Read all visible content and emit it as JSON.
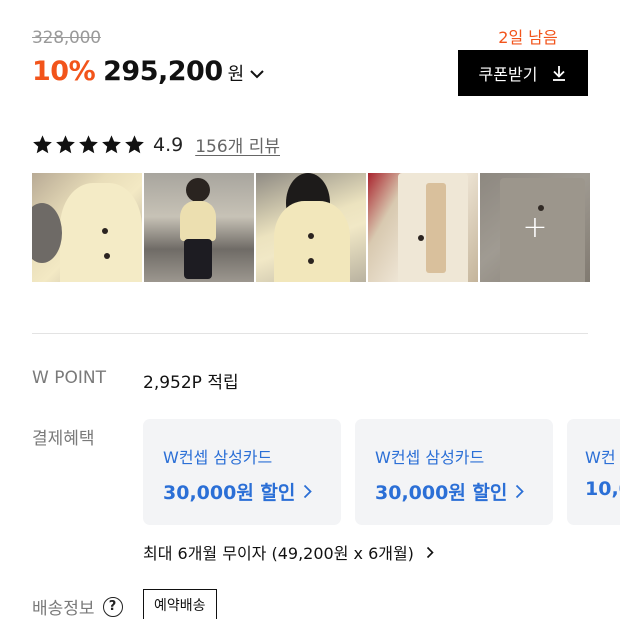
{
  "price": {
    "original": "328,000",
    "discount": "10%",
    "sale": "295,200",
    "currency": "원"
  },
  "coupon": {
    "remaining": "2일 남음",
    "button_label": "쿠폰받기"
  },
  "rating": {
    "value": "4.9",
    "stars": 5,
    "review_link": "156개 리뷰"
  },
  "photos": {
    "count_shown": 5,
    "more_symbol": "+"
  },
  "points": {
    "label": "W POINT",
    "value": "2,952P 적립"
  },
  "payment": {
    "label": "결제혜택",
    "cards": [
      {
        "title": "W컨셉 삼성카드",
        "amount": "30,000원 할인"
      },
      {
        "title": "W컨셉 삼성카드",
        "amount": "30,000원 할인"
      },
      {
        "title": "W컨",
        "amount": "10,0"
      }
    ],
    "installment": "최대 6개월 무이자 (49,200원 x 6개월)"
  },
  "shipping": {
    "label": "배송정보",
    "help_symbol": "?",
    "badge": "예약배송"
  },
  "colors": {
    "accent": "#f2541b",
    "card_blue": "#2b6fd6",
    "card_bg": "#f3f4f6"
  }
}
